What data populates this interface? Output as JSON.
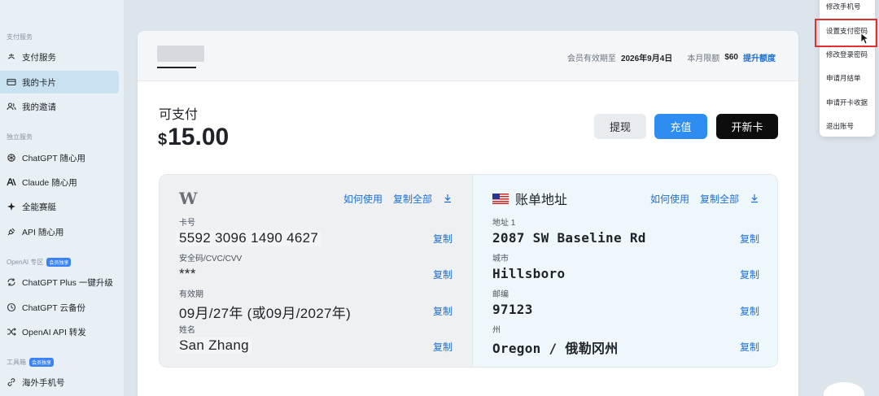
{
  "sidebar": {
    "groups": [
      {
        "label": "支付服务",
        "badge": ""
      },
      {
        "label": "独立服务",
        "badge": ""
      },
      {
        "label": "OpenAI 专区",
        "badge": "会员独享"
      },
      {
        "label": "工具箱",
        "badge": "会员独享"
      }
    ],
    "items": [
      {
        "label": "支付服务",
        "icon": "payment-icon"
      },
      {
        "label": "我的卡片",
        "icon": "card-icon"
      },
      {
        "label": "我的邀请",
        "icon": "users-icon"
      },
      {
        "label": "ChatGPT 随心用",
        "icon": "openai-icon"
      },
      {
        "label": "Claude 随心用",
        "icon": "anthropic-icon"
      },
      {
        "label": "全能赛艇",
        "icon": "sparkle-icon"
      },
      {
        "label": "API 随心用",
        "icon": "plug-icon"
      },
      {
        "label": "ChatGPT Plus 一键升级",
        "icon": "upgrade-icon"
      },
      {
        "label": "ChatGPT 云备份",
        "icon": "clock-icon"
      },
      {
        "label": "OpenAI API 转发",
        "icon": "shuffle-icon"
      },
      {
        "label": "海外手机号",
        "icon": "phone-link-icon"
      }
    ]
  },
  "header": {
    "membership_label": "会员有效期至",
    "membership_date": "2026年9月4日",
    "limit_label": "本月限额",
    "limit_value": "$60",
    "limit_link": "提升额度"
  },
  "balance": {
    "label": "可支付",
    "currency": "$",
    "amount": "15.00"
  },
  "actions": {
    "withdraw": "提现",
    "recharge": "充值",
    "new_card": "开新卡"
  },
  "card": {
    "logo": "W",
    "how_to_use": "如何使用",
    "copy_all": "复制全部",
    "copy": "复制",
    "fields": [
      {
        "label": "卡号",
        "value": "5592 3096 1490 4627"
      },
      {
        "label": "安全码/CVC/CVV",
        "value": "***"
      },
      {
        "label": "有效期",
        "value": "09月/27年 (或09月/2027年)"
      },
      {
        "label": "姓名",
        "value": "San Zhang"
      }
    ]
  },
  "billing": {
    "title": "账单地址",
    "how_to_use": "如何使用",
    "copy_all": "复制全部",
    "copy": "复制",
    "fields": [
      {
        "label": "地址 1",
        "value": "2087 SW Baseline Rd"
      },
      {
        "label": "城市",
        "value": "Hillsboro"
      },
      {
        "label": "邮编",
        "value": "97123"
      },
      {
        "label": "州",
        "value": "Oregon / 俄勒冈州"
      }
    ]
  },
  "dropdown": {
    "items": [
      "修改手机号",
      "设置支付密码",
      "修改登录密码",
      "申请月结单",
      "申请开卡收据",
      "退出账号"
    ],
    "highlighted_index": 1
  },
  "colors": {
    "primary": "#2f8cf0",
    "link": "#1f6fd1",
    "dark_button": "#0d0d0d",
    "highlight_border": "#e03030"
  }
}
